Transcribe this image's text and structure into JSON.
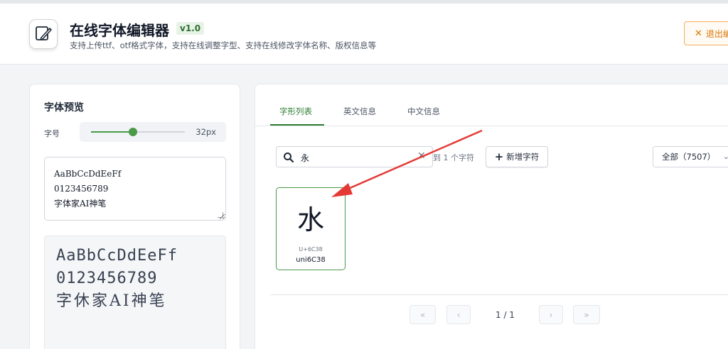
{
  "header": {
    "app_title": "在线字体编辑器",
    "version": "v1.0",
    "subtitle": "支持上传ttf、otf格式字体，支持在线调整字型、支持在线修改字体名称、版权信息等",
    "exit_label": "退出编辑"
  },
  "preview": {
    "title": "字体预览",
    "size_label": "字号",
    "size_value": "32px",
    "size_fraction": 0.45,
    "input_lines": [
      "AaBbCcDdEeFf",
      "0123456789",
      "字体家AI神笔"
    ],
    "render_lines": [
      "AaBbCcDdEeFf",
      "0123456789",
      "字休家AI神笔"
    ]
  },
  "tabs": [
    {
      "label": "字形列表",
      "active": true
    },
    {
      "label": "英文信息",
      "active": false
    },
    {
      "label": "中文信息",
      "active": false
    }
  ],
  "search": {
    "value": "永",
    "match_text": "到 1 个字符"
  },
  "add_button": "新增字符",
  "filter": {
    "selected": "全部（7507）"
  },
  "glyphs": [
    {
      "char": "水",
      "code": "U+6C38",
      "name": "uni6C38"
    }
  ],
  "pagination": {
    "first": "«",
    "prev": "‹",
    "page_text": "1 / 1",
    "next": "›",
    "last": "»"
  },
  "colors": {
    "accent": "#2f7d32",
    "warning": "#d97706",
    "annotation": "#e53935"
  }
}
